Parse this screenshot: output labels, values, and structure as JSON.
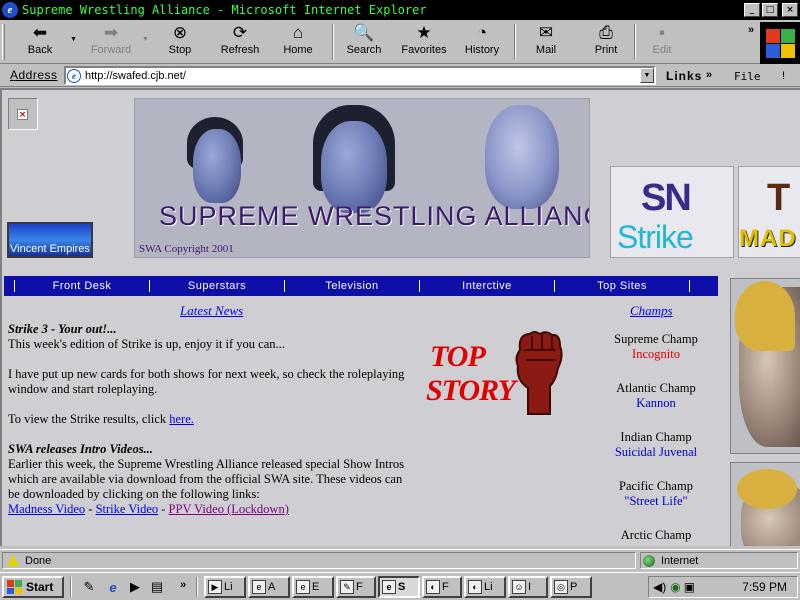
{
  "window": {
    "title": "Supreme Wrestling Alliance - Microsoft Internet Explorer",
    "controls": {
      "minimize": "_",
      "maximize": "□",
      "close": "×"
    }
  },
  "toolbar": {
    "back": "Back",
    "forward": "Forward",
    "stop": "Stop",
    "refresh": "Refresh",
    "home": "Home",
    "search": "Search",
    "favorites": "Favorites",
    "history": "History",
    "mail": "Mail",
    "print": "Print",
    "edit": "Edit"
  },
  "address": {
    "label": "Address",
    "url": "http://swafed.cjb.net/",
    "links_label": "Links",
    "file_menu": "File"
  },
  "page": {
    "left_banner": "Vincent Empires",
    "hero_title": "SUPREME WRESTLING ALLIANCE",
    "hero_copyright": "SWA Copyright 2001",
    "logo_sn_big": "SN",
    "logo_sn_small": "Strike",
    "logo_tm_big": "T",
    "logo_tm_small": "MAD",
    "nav": [
      "Front Desk",
      "Superstars",
      "Television",
      "Interctive",
      "Top Sites"
    ],
    "latest_news": "Latest News",
    "champs_title": "Champs",
    "top_story_1": "TOP",
    "top_story_2": "STORY",
    "news": {
      "h1": "Strike 3 - Your out!...",
      "p1": "This week's edition of Strike is up, enjoy it if you can...",
      "p2": "I have put up new cards for both shows for next week, so check the roleplaying window and start roleplaying.",
      "p3_prefix": "To view the Strike results, click ",
      "p3_link": "here.",
      "h2": "SWA releases Intro Videos...",
      "p4": "Earlier this week, the Supreme Wrestling Alliance released special Show Intros which are available via download from the official SWA site. These videos can be downloaded by clicking on the following links:",
      "link_madness": "Madness Video",
      "dash": " - ",
      "link_strike": "Strike Video",
      "link_ppv": "PPV Video (Lockdown)"
    },
    "champs": [
      {
        "title": "Supreme Champ",
        "holder": "Incognito",
        "color": "#e00000"
      },
      {
        "title": "Atlantic Champ",
        "holder": "Kannon",
        "color": "#0000cc"
      },
      {
        "title": "Indian Champ",
        "holder": "Suicidal Juvenal",
        "color": "#0000cc"
      },
      {
        "title": "Pacific Champ",
        "holder": "\"Street Life\"",
        "color": "#0000cc"
      },
      {
        "title": "Arctic Champ",
        "holder": "",
        "color": "#0000cc"
      }
    ]
  },
  "status": {
    "text": "Done",
    "zone": "Internet"
  },
  "taskbar": {
    "start": "Start",
    "tasks": [
      "Li",
      "A",
      "E",
      "F",
      "S",
      "F",
      "Li",
      "I",
      "P"
    ],
    "clock": "7:59 PM"
  },
  "colors": {
    "title_text": "#3cff3c",
    "nav_bar": "#0e0ea8",
    "link": "#0000ee",
    "visited": "#800080",
    "page_bg": "#cfcfd3"
  }
}
